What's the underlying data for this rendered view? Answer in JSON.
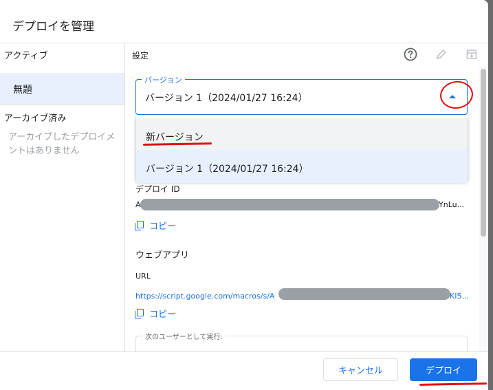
{
  "dialog": {
    "title": "デプロイを管理"
  },
  "sidebar": {
    "active_label": "アクティブ",
    "active_items": [
      {
        "label": "無題"
      }
    ],
    "archived_label": "アーカイブ済み",
    "archived_empty": "アーカイブしたデプロイメントはありません"
  },
  "settings": {
    "label": "設定",
    "toolbar_icons": [
      "help-icon",
      "edit-icon",
      "archive-icon"
    ],
    "version": {
      "label": "バージョン",
      "value": "バージョン 1（2024/01/27 16:24）",
      "options": [
        "新バージョン",
        "バージョン 1（2024/01/27 16:24）"
      ]
    },
    "deploy_id": {
      "label": "デプロイ ID",
      "prefix": "A",
      "suffix": "YnLu...",
      "copy_label": "コピー"
    },
    "web_app": {
      "title": "ウェブアプリ",
      "url_label": "URL",
      "url_prefix": "https://script.google.com/macros/s/A",
      "url_suffix": "KI5...",
      "copy_label": "コピー"
    },
    "execute_as": {
      "label": "次のユーザーとして実行:"
    }
  },
  "footer": {
    "cancel_label": "キャンセル",
    "deploy_label": "デプロイ"
  },
  "colors": {
    "accent": "#1a73e8",
    "annotation": "#e01010",
    "selected_bg": "#e8f0fe"
  }
}
